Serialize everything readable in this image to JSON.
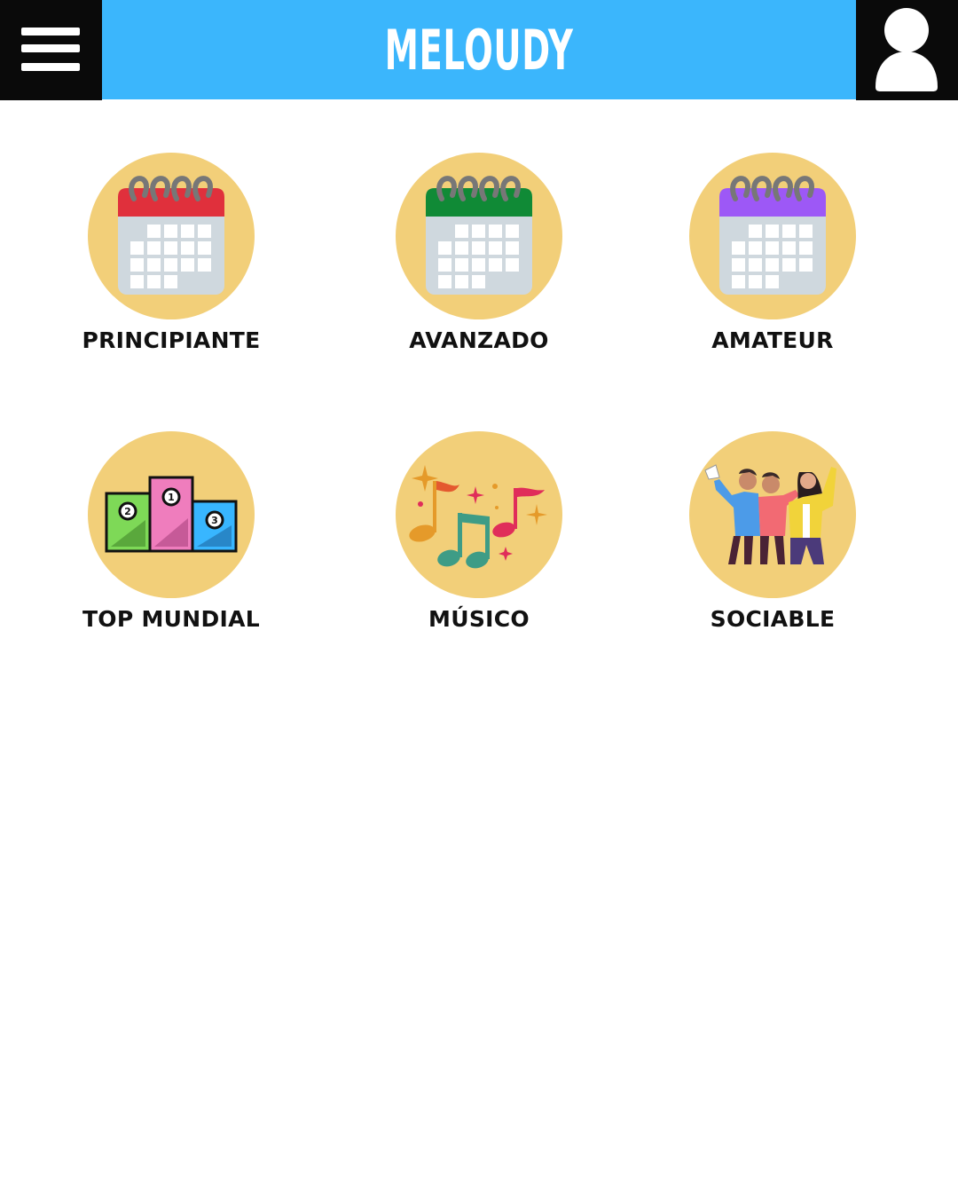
{
  "app": {
    "title": "MELOUDY",
    "header_color": "#3bb6fc",
    "menu_icon": "hamburger-menu-icon",
    "profile_icon": "user-profile-icon"
  },
  "categories": [
    {
      "label": "PRINCIPIANTE",
      "icon": "calendar-icon",
      "accent": "#e0303c"
    },
    {
      "label": "AVANZADO",
      "icon": "calendar-icon",
      "accent": "#108a36"
    },
    {
      "label": "AMATEUR",
      "icon": "calendar-icon",
      "accent": "#9d58f6"
    },
    {
      "label": "TOP MUNDIAL",
      "icon": "podium-icon",
      "accent": "#ef7dbd"
    },
    {
      "label": "MÚSICO",
      "icon": "music-notes-icon",
      "accent": "#e59a2a"
    },
    {
      "label": "SOCIABLE",
      "icon": "friends-group-icon",
      "accent": "#f1d33a"
    }
  ]
}
